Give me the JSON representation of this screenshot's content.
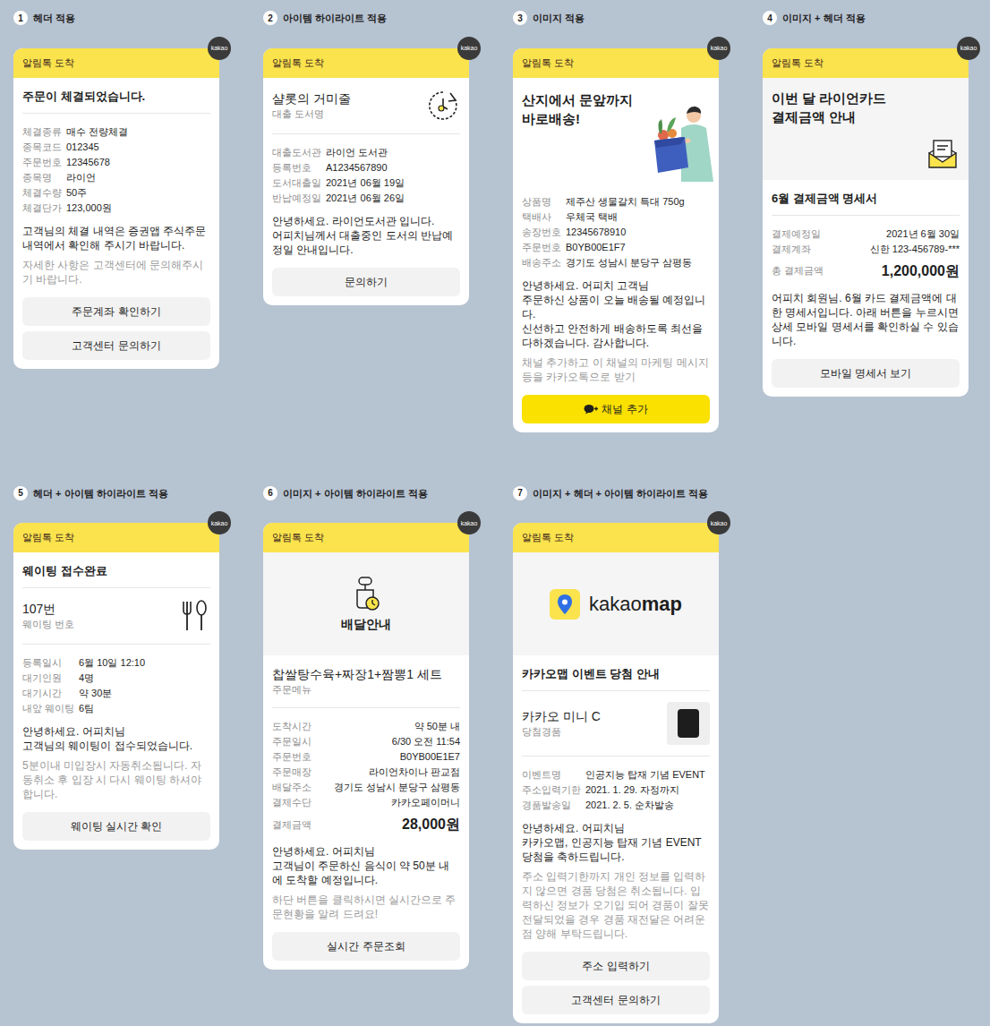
{
  "banner_title": "알림톡 도착",
  "badge": "kakao",
  "cards": [
    {
      "number": "1",
      "label": "헤더 적용",
      "header": "주문이 체결되었습니다.",
      "image": null,
      "highlight": null,
      "items": [
        {
          "label": "체결종류",
          "value": "매수 전량체결"
        },
        {
          "label": "종목코드",
          "value": "012345"
        },
        {
          "label": "주문번호",
          "value": "12345678"
        },
        {
          "label": "종목명",
          "value": "라이언"
        },
        {
          "label": "체결수량",
          "value": "50주"
        },
        {
          "label": "체결단가",
          "value": "123,000원"
        }
      ],
      "total": null,
      "body": "고객님의 체결 내역은 증권앱 주식주문내역에서 확인해 주시기 바랍니다.",
      "note": "자세한 사항은 고객센터에 문의해주시기 바랍니다.",
      "buttons": [
        {
          "label": "주문계좌 확인하기",
          "kind": "plain"
        },
        {
          "label": "고객센터 문의하기",
          "kind": "plain"
        }
      ]
    },
    {
      "number": "2",
      "label": "아이템 하이라이트 적용",
      "header": null,
      "image": null,
      "highlight": {
        "title": "샬롯의 거미줄",
        "subtitle": "대출 도서명",
        "kind": "timer"
      },
      "items": [
        {
          "label": "대출도서관",
          "value": "라이언 도서관"
        },
        {
          "label": "등록번호",
          "value": "A1234567890"
        },
        {
          "label": "도서대출일",
          "value": "2021년 06월 19일"
        },
        {
          "label": "반납예정일",
          "value": "2021년 06월 26일"
        }
      ],
      "total": null,
      "body": "안녕하세요. 라이언도서관 입니다.\n어피치님께서 대출중인 도서의 반납예정일 안내입니다.",
      "note": null,
      "buttons": [
        {
          "label": "문의하기",
          "kind": "plain"
        }
      ]
    },
    {
      "number": "3",
      "label": "이미지 적용",
      "header": null,
      "image": {
        "kind": "delivery",
        "title": "산지에서 문앞까지\n바로배송!"
      },
      "highlight": null,
      "items": [
        {
          "label": "상품명",
          "value": "제주산 생물갈치 특대 750g"
        },
        {
          "label": "택배사",
          "value": "우체국 택배"
        },
        {
          "label": "송장번호",
          "value": "12345678910"
        },
        {
          "label": "주문번호",
          "value": "B0YB00E1F7"
        },
        {
          "label": "배송주소",
          "value": "경기도 성남시 분당구 삼평동"
        }
      ],
      "total": null,
      "body": "안녕하세요. 어피치 고객님\n주문하신 상품이 오늘 배송될 예정입니다.\n신선하고 안전하게 배송하도록 최선을 다하겠습니다. 감사합니다.",
      "note": "채널 추가하고 이 채널의 마케팅 메시지 등을 카카오톡으로 받기",
      "buttons": [
        {
          "label": "채널 추가",
          "kind": "channel"
        }
      ]
    },
    {
      "number": "4",
      "label": "이미지 + 헤더 적용",
      "header": "6월 결제금액 명세서",
      "image": {
        "kind": "envelope",
        "title": "이번 달 라이언카드\n결제금액 안내"
      },
      "highlight": null,
      "items": [
        {
          "label": "결제예정일",
          "value": "2021년 6월 30일"
        },
        {
          "label": "결제계좌",
          "value": "신한 123-456789-***"
        }
      ],
      "total": {
        "label": "총 결제금액",
        "value": "1,200,000원"
      },
      "body": "어피치 회원님. 6월 카드 결제금액에 대한 명세서입니다. 아래 버튼을 누르시면 상세 모바일 명세서를 확인하실 수 있습니다.",
      "note": null,
      "buttons": [
        {
          "label": "모바일 명세서 보기",
          "kind": "plain"
        }
      ]
    },
    {
      "number": "5",
      "label": "헤더 + 아이템 하이라이트 적용",
      "header": "웨이팅 접수완료",
      "image": null,
      "highlight": {
        "title": "107번",
        "subtitle": "웨이팅 번호",
        "kind": "cutlery"
      },
      "items": [
        {
          "label": "등록일시",
          "value": "6월 10일 12:10"
        },
        {
          "label": "대기인원",
          "value": "4명"
        },
        {
          "label": "대기시간",
          "value": "약 30분"
        },
        {
          "label": "내앞 웨이팅",
          "value": "6팀"
        }
      ],
      "total": null,
      "body": "안녕하세요. 어피치님\n고객님의 웨이팅이 접수되었습니다.",
      "note": "5분이내 미입장시 자동취소됩니다. 자동취소 후 입장 시 다시 웨이팅 하셔야 합니다.",
      "buttons": [
        {
          "label": "웨이팅 실시간 확인",
          "kind": "plain"
        }
      ]
    },
    {
      "number": "6",
      "label": "이미지 + 아이템 하이라이트 적용",
      "header": null,
      "image": {
        "kind": "scooter",
        "title": "배달안내"
      },
      "highlight": {
        "title": "찹쌀탕수육+짜장1+짬뽕1 세트",
        "subtitle": "주문메뉴",
        "kind": "none"
      },
      "items": [
        {
          "label": "도착시간",
          "value": "약 50분 내"
        },
        {
          "label": "주문일시",
          "value": "6/30 오전 11:54"
        },
        {
          "label": "주문번호",
          "value": "B0YB00E1E7"
        },
        {
          "label": "주문매장",
          "value": "라이언차이나 판교점"
        },
        {
          "label": "배달주소",
          "value": "경기도 성남시 분당구 삼평동"
        },
        {
          "label": "결제수단",
          "value": "카카오페이머니"
        }
      ],
      "total": {
        "label": "결제금액",
        "value": "28,000원"
      },
      "body": "안녕하세요. 어피치님\n고객님이 주문하신 음식이 약 50분 내에 도착할 예정입니다.",
      "note": "하단 버튼을 클릭하시면 실시간으로 주문현황을 알려 드려요!",
      "buttons": [
        {
          "label": "실시간 주문조회",
          "kind": "plain"
        }
      ]
    },
    {
      "number": "7",
      "label": "이미지 + 헤더 + 아이템 하이라이트 적용",
      "header": "카카오맵 이벤트 당첨 안내",
      "image": {
        "kind": "logo",
        "title": "kakao",
        "title_bold": "map"
      },
      "highlight": {
        "title": "카카오 미니 C",
        "subtitle": "당첨경품",
        "kind": "product"
      },
      "items": [
        {
          "label": "이벤트명",
          "value": "인공지능 탑재 기념 EVENT"
        },
        {
          "label": "주소입력기한",
          "value": "2021. 1. 29. 자정까지"
        },
        {
          "label": "경품발송일",
          "value": "2021. 2. 5. 순차발송"
        }
      ],
      "total": null,
      "body": "안녕하세요. 어피치님\n카카오맵, 인공지능 탑재 기념 EVENT 당첨을 축하드립니다.",
      "note": "주소 입력기한까지 개인 정보를 입력하지 않으면 경품 당첨은 취소됩니다. 입력하신 정보가 오기입 되어 경품이 잘못 전달되었을 경우 경품 재전달은 어려운 점 양해 부탁드립니다.",
      "buttons": [
        {
          "label": "주소 입력하기",
          "kind": "plain"
        },
        {
          "label": "고객센터 문의하기",
          "kind": "plain"
        }
      ]
    }
  ]
}
